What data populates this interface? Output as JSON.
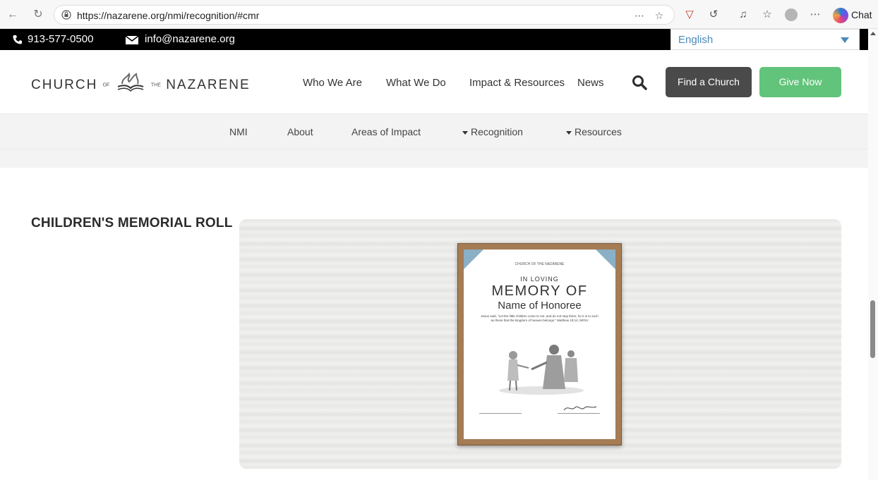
{
  "browser": {
    "url": "https://nazarene.org/nmi/recognition/#cmr",
    "chat_label": "Chat"
  },
  "topbar": {
    "phone": "913-577-0500",
    "email": "info@nazarene.org",
    "language": "English"
  },
  "header": {
    "brand_left": "CHURCH",
    "brand_of": "OF",
    "brand_the": "THE",
    "brand_right": "NAZARENE",
    "nav": [
      "Who We Are",
      "What We Do",
      "Impact & Resources",
      "News"
    ],
    "find_church": "Find a Church",
    "give_now": "Give Now"
  },
  "subnav": {
    "items": [
      "NMI",
      "About",
      "Areas of Impact",
      "Recognition",
      "Resources"
    ]
  },
  "content": {
    "section_title": "CHILDREN'S MEMORIAL ROLL",
    "certificate": {
      "org": "CHURCH OF THE NAZARENE",
      "line1": "IN LOVING",
      "line2": "MEMORY OF",
      "line3": "Name of Honoree",
      "verse": "Jesus said, \"Let the little children come to me, and do not stop them; for it is to such as these that the kingdom of heaven belongs.\" Matthew 19:14, NRSV"
    }
  },
  "colors": {
    "give_green": "#62c37a",
    "find_dark": "#4a4a4a",
    "lang_blue": "#4a8ab8"
  }
}
